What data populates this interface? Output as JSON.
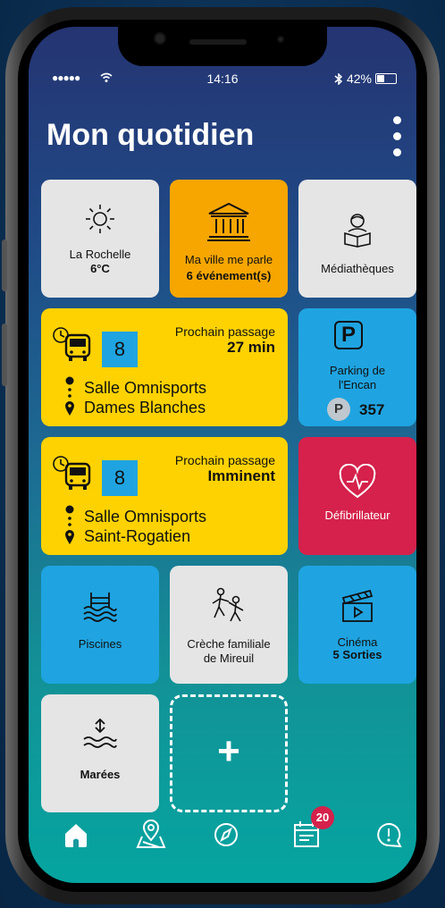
{
  "status_bar": {
    "signal": "●●●●●",
    "time": "14:16",
    "battery": "42%",
    "battery_level": 0.42
  },
  "header": {
    "title": "Mon quotidien"
  },
  "tiles": {
    "weather": {
      "city": "La Rochelle",
      "temp": "6°C"
    },
    "city_talks": {
      "label": "Ma ville me parle",
      "events": "6 événement(s)"
    },
    "libraries": {
      "label": "Médiathèques"
    },
    "bus1": {
      "line": "8",
      "next_label": "Prochain passage",
      "next_value": "27 min",
      "stop": "Salle Omnisports",
      "destination": "Dames Blanches"
    },
    "parking": {
      "letter": "P",
      "name_line1": "Parking de",
      "name_line2": "l'Encan",
      "badge": "P",
      "spaces": "357"
    },
    "bus2": {
      "line": "8",
      "next_label": "Prochain passage",
      "next_value": "Imminent",
      "stop": "Salle Omnisports",
      "destination": "Saint-Rogatien"
    },
    "defib": {
      "label": "Défibrillateur"
    },
    "pools": {
      "label": "Piscines"
    },
    "daycare": {
      "line1": "Crèche familiale",
      "line2": "de Mireuil"
    },
    "cinema": {
      "label": "Cinéma",
      "count": "5 Sorties"
    },
    "tides": {
      "label": "Marées"
    },
    "add": {
      "symbol": "+"
    }
  },
  "tabbar": {
    "agenda_badge": "20"
  },
  "colors": {
    "gray": "#e5e5e5",
    "orange": "#f7a600",
    "yellow": "#fed200",
    "blue": "#1fa4e1",
    "red": "#d5214b"
  }
}
